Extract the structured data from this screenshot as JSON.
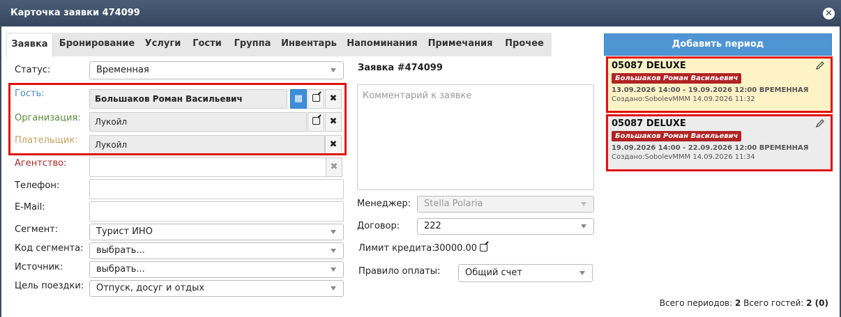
{
  "window": {
    "title": "Карточка заявки 474099"
  },
  "tabs": [
    "Заявка",
    "Бронирование",
    "Услуги",
    "Гости",
    "Группа",
    "Инвентарь",
    "Напоминания",
    "Примечания",
    "Прочее"
  ],
  "form": {
    "status": {
      "label": "Статус:",
      "value": "Временная"
    },
    "guest": {
      "label": "Гость:",
      "value": "Большаков Роман Васильевич"
    },
    "organization": {
      "label": "Организация:",
      "value": "Лукойл"
    },
    "payer": {
      "label": "Плательщик:",
      "value": "Лукойл"
    },
    "agency": {
      "label": "Агентство:",
      "value": ""
    },
    "phone": {
      "label": "Телефон:",
      "value": ""
    },
    "email": {
      "label": "E-Mail:",
      "value": ""
    },
    "segment": {
      "label": "Сегмент:",
      "value": "Турист ИНО"
    },
    "segment_code": {
      "label": "Код сегмента:",
      "value": "выбрать..."
    },
    "source": {
      "label": "Источник:",
      "value": "выбрать..."
    },
    "trip_purpose": {
      "label": "Цель поездки:",
      "value": "Отпуск, досуг и отдых"
    }
  },
  "details": {
    "title": "Заявка #474099",
    "comment_placeholder": "Комментарий к заявке",
    "manager": {
      "label": "Менеджер:",
      "value": "Stella Polaria"
    },
    "contract": {
      "label": "Договор:",
      "value": "222"
    },
    "credit_limit": {
      "label": "Лимит кредита:",
      "value": "30000.00"
    },
    "payment_rule": {
      "label": "Правило оплаты:",
      "value": "Общий счет"
    }
  },
  "periods": {
    "add_button": "Добавить период",
    "items": [
      {
        "room": "05087 DELUXE",
        "guest": "Большаков Роман Васильевич",
        "dates": "13.09.2026 14:00 - 19.09.2026 12:00 ВРЕМЕННАЯ",
        "created": "Создано:SobolevMMM 14.09.2026 11:32",
        "bg": "#fdf3c7"
      },
      {
        "room": "05087 DELUXE",
        "guest": "Большаков Роман Васильевич",
        "dates": "19.09.2026 14:00 - 22.09.2026 12:00 ВРЕМЕННАЯ",
        "created": "Создано:SobolevMMM 14.09.2026 11:34",
        "bg": "#ececec"
      }
    ],
    "summary": {
      "periods_label": "Всего периодов:",
      "periods_value": "2",
      "guests_label": "Всего гостей:",
      "guests_value": "2 (0)"
    }
  },
  "colors": {
    "titlebar": "#3b4d66",
    "accent": "#4f95d3",
    "highlight": "#e01010",
    "badge": "#b12323"
  }
}
